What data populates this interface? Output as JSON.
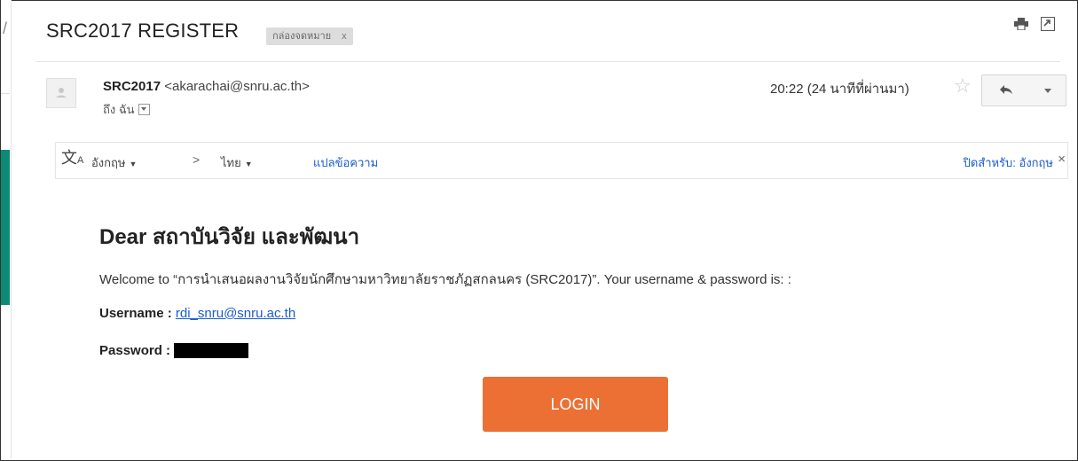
{
  "window": {
    "subject": "SRC2017 REGISTER",
    "label_chip": "กล่องจดหมาย",
    "label_chip_close": "x",
    "left_rail_glyph": "/"
  },
  "message_header": {
    "sender_name": "SRC2017",
    "sender_email": "<akarachai@snru.ac.th>",
    "to_line": "ถึง ฉัน",
    "timestamp": "20:22 (24 นาทีที่ผ่านมา)"
  },
  "translate_bar": {
    "from_language": "อังกฤษ",
    "arrow": ">",
    "to_language": "ไทย",
    "translate_link": "แปลข้อความ",
    "turn_off_label": "ปิดสำหรับ: อังกฤษ",
    "close_glyph": "×"
  },
  "body": {
    "greeting": "Dear สถาบันวิจัย และพัฒนา",
    "welcome_text": "Welcome to “การนำเสนอผลงานวิจัยนักศึกษามหาวิทยาลัยราชภัฏสกลนคร (SRC2017)”. Your username & password is: :",
    "username_label": "Username :",
    "username_value": "rdi_snru@snru.ac.th",
    "password_label": "Password :",
    "login_button": "LOGIN"
  },
  "colors": {
    "login_button": "#ec7034",
    "link": "#1a5ccc",
    "rail_accent": "#0d8a75"
  },
  "icons": {
    "print": "print-icon",
    "new_window": "new-window-icon",
    "avatar": "avatar-icon",
    "star": "star-icon",
    "reply": "reply-icon",
    "more": "chevron-down-icon",
    "translate": "translate-icon"
  }
}
